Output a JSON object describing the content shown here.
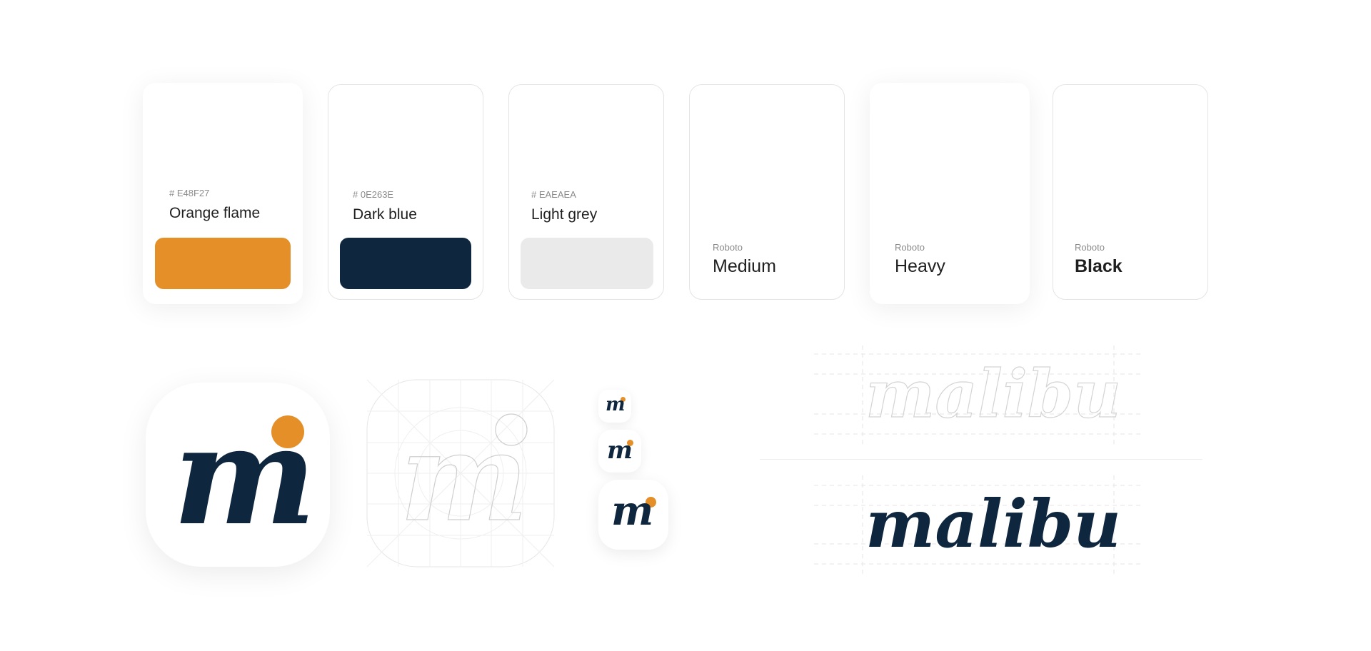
{
  "colors": [
    {
      "hex": "# E48F27",
      "name": "Orange flame",
      "value": "#E48F27"
    },
    {
      "hex": "# 0E263E",
      "name": "Dark blue",
      "value": "#0E263E"
    },
    {
      "hex": "# EAEAEA",
      "name": "Light grey",
      "value": "#EAEAEA"
    }
  ],
  "fonts": [
    {
      "family": "Roboto",
      "weight": "Medium"
    },
    {
      "family": "Roboto",
      "weight": "Heavy"
    },
    {
      "family": "Roboto",
      "weight": "Black"
    }
  ],
  "logo": {
    "mark": "m",
    "wordmark": "malibu",
    "primary_color": "#0E263E",
    "accent_color": "#E48F27",
    "outline_color": "#d6d6d6"
  }
}
